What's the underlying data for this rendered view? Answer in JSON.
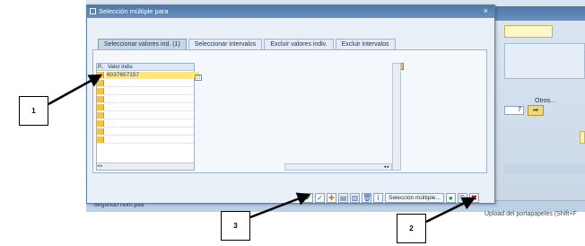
{
  "dialog": {
    "title": "Selección múltiple para",
    "close_label": "×",
    "tabs": [
      {
        "label": "Seleccionar valores ind. (1)"
      },
      {
        "label": "Seleccionar intervalos"
      },
      {
        "label": "Excluir valores indiv."
      },
      {
        "label": "Excluir intervalos"
      }
    ],
    "table": {
      "col_p": "P..",
      "col_value": "Valor indiv.",
      "rows": [
        "6037657157",
        "",
        "",
        "",
        "",
        "",
        "",
        "",
        ""
      ]
    },
    "toolbar": {
      "multi_select_label": "Selección múltiple..."
    }
  },
  "background": {
    "otros_label": "Otros...",
    "field_value": "7",
    "second_label": "Segundo nom.pila",
    "upload_label": "Upload del portapapeles   (Shift+F"
  },
  "callouts": {
    "c1": "1",
    "c2": "2",
    "c3": "3"
  }
}
